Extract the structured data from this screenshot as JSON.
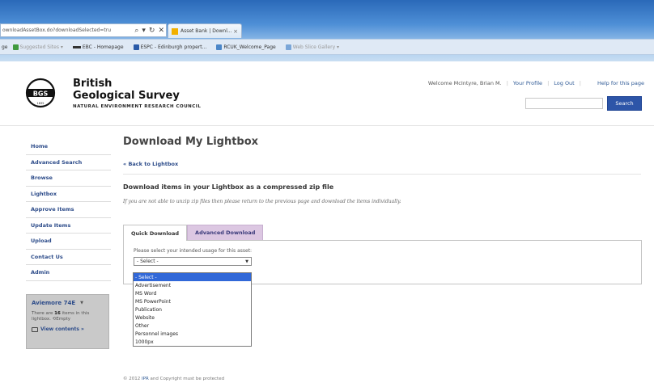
{
  "browser": {
    "url": "ownloadAssetBox.do?downloadSelected=tru",
    "tab_label": "Asset Bank | Downl...",
    "tab_close": "×",
    "favorites": [
      {
        "label": "Suggested Sites ▾",
        "dim": true
      },
      {
        "label": "EBC - Homepage"
      },
      {
        "label": "ESPC - Edinburgh propert..."
      },
      {
        "label": "RCUK_Welcome_Page"
      },
      {
        "label": "Web Slice Gallery ▾",
        "dim": true
      }
    ],
    "favbar_prefix": "ge"
  },
  "header": {
    "brand_line1": "British",
    "brand_line2": "Geological Survey",
    "brand_line3": "NATURAL ENVIRONMENT RESEARCH COUNCIL",
    "logo_text": "BGS",
    "logo_year": "1835",
    "welcome": "Welcome McIntyre, Brian M.",
    "your_profile": "Your Profile",
    "log_out": "Log Out",
    "help": "Help for this page",
    "search_button": "Search",
    "search_placeholder": ""
  },
  "sidebar": {
    "items": [
      "Home",
      "Advanced Search",
      "Browse",
      "Lightbox",
      "Approve Items",
      "Update Items",
      "Upload",
      "Contact Us",
      "Admin"
    ]
  },
  "lightbox": {
    "name": "Aviemore 74E",
    "text_pre": "There are",
    "count": "16",
    "text_post": "items in this lightbox.",
    "empty": "Empty",
    "view_contents": "View contents »"
  },
  "main": {
    "title": "Download My Lightbox",
    "back_link": "« Back to Lightbox",
    "section_title": "Download items in your Lightbox as a compressed zip file",
    "help_text": "If you are not able to unzip zip files then please return to the previous page and download the items individually.",
    "tabs": [
      "Quick Download",
      "Advanced Download"
    ],
    "usage_label": "Please select your intended usage for this asset:",
    "selected_value": "- Select -",
    "options": [
      "- Select -",
      "Advertisement",
      "MS Word",
      "MS PowerPoint",
      "Publication",
      "Website",
      "Other",
      "Personnel images",
      "1000px"
    ]
  },
  "footer": {
    "prefix": "© 2012",
    "link": "IPR",
    "suffix": "and Copyright must be protected"
  }
}
